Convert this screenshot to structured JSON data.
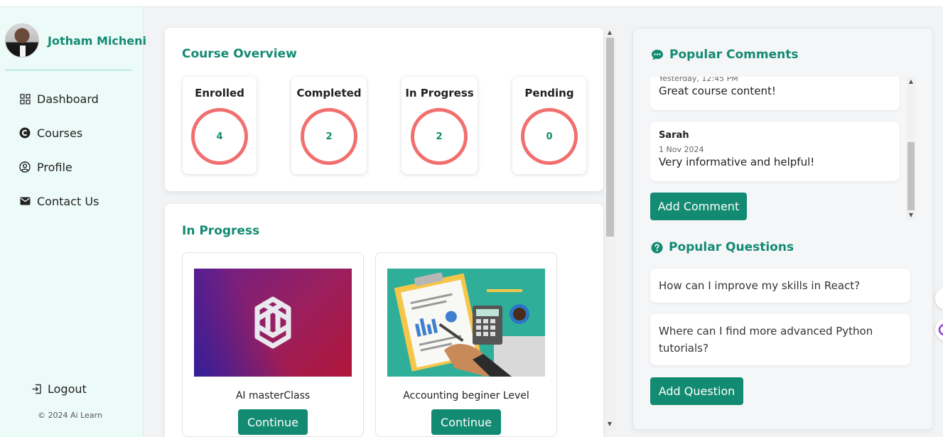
{
  "user": {
    "name": "Jotham Micheni"
  },
  "nav": [
    {
      "label": "Dashboard",
      "icon": "grid-icon"
    },
    {
      "label": "Courses",
      "icon": "courses-icon"
    },
    {
      "label": "Profile",
      "icon": "user-circle-icon"
    },
    {
      "label": "Contact Us",
      "icon": "envelope-icon"
    }
  ],
  "logout_label": "Logout",
  "copyright": "© 2024 Ai Learn",
  "overview": {
    "title": "Course Overview",
    "stats": [
      {
        "label": "Enrolled",
        "value": "4"
      },
      {
        "label": "Completed",
        "value": "2"
      },
      {
        "label": "In Progress",
        "value": "2"
      },
      {
        "label": "Pending",
        "value": "0"
      }
    ]
  },
  "in_progress": {
    "title": "In Progress",
    "courses": [
      {
        "title": "AI masterClass",
        "button": "Continue",
        "image": "openai-logo"
      },
      {
        "title": "Accounting beginer Level",
        "button": "Continue",
        "image": "accounting-illustration"
      }
    ]
  },
  "comments": {
    "title": "Popular Comments",
    "items": [
      {
        "author": "",
        "date": "Yesterday, 12:45 PM",
        "text": "Great course content!"
      },
      {
        "author": "Sarah",
        "date": "1 Nov 2024",
        "text": "Very informative and helpful!"
      }
    ],
    "add_label": "Add Comment"
  },
  "questions": {
    "title": "Popular Questions",
    "items": [
      "How can I improve my skills in React?",
      "Where can I find more advanced Python tutorials?"
    ],
    "add_label": "Add Question"
  },
  "colors": {
    "accent": "#138a72",
    "ring": "#f26f6f",
    "sidebar_bg": "#edfbf8"
  }
}
